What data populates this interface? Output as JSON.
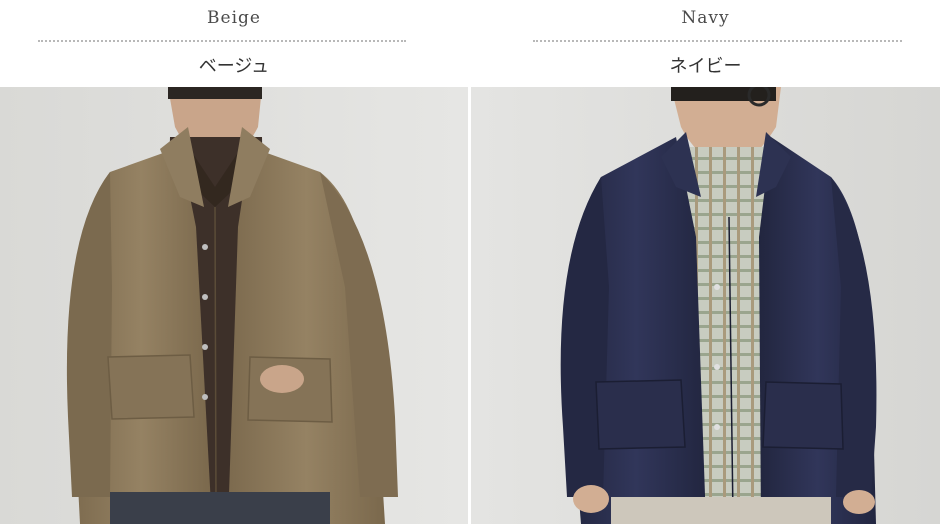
{
  "colors": [
    {
      "name_en": "Beige",
      "name_jp": "ベージュ",
      "swatch": "#8c7a5e"
    },
    {
      "name_en": "Navy",
      "name_jp": "ネイビー",
      "swatch": "#2b2f4f"
    }
  ]
}
